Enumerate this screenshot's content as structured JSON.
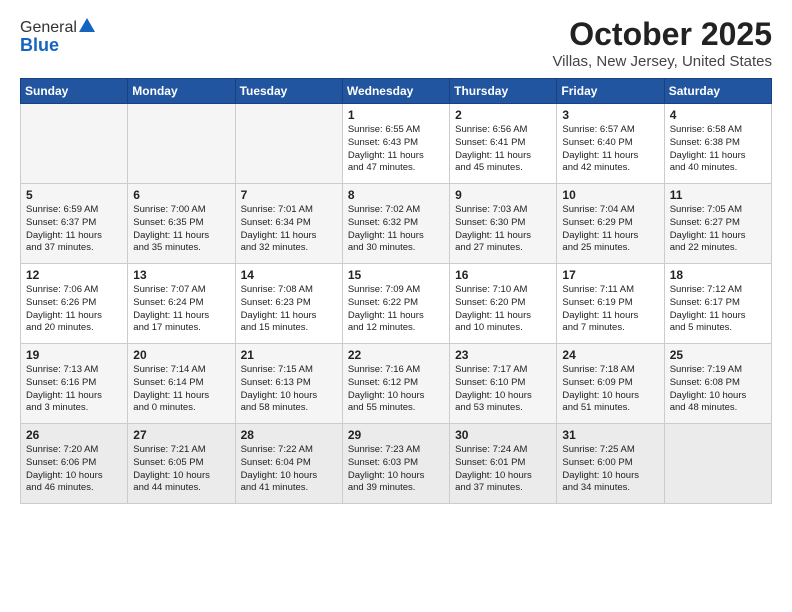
{
  "header": {
    "logo_general": "General",
    "logo_blue": "Blue",
    "title": "October 2025",
    "subtitle": "Villas, New Jersey, United States"
  },
  "weekdays": [
    "Sunday",
    "Monday",
    "Tuesday",
    "Wednesday",
    "Thursday",
    "Friday",
    "Saturday"
  ],
  "weeks": [
    [
      {
        "num": "",
        "info": ""
      },
      {
        "num": "",
        "info": ""
      },
      {
        "num": "",
        "info": ""
      },
      {
        "num": "1",
        "info": "Sunrise: 6:55 AM\nSunset: 6:43 PM\nDaylight: 11 hours\nand 47 minutes."
      },
      {
        "num": "2",
        "info": "Sunrise: 6:56 AM\nSunset: 6:41 PM\nDaylight: 11 hours\nand 45 minutes."
      },
      {
        "num": "3",
        "info": "Sunrise: 6:57 AM\nSunset: 6:40 PM\nDaylight: 11 hours\nand 42 minutes."
      },
      {
        "num": "4",
        "info": "Sunrise: 6:58 AM\nSunset: 6:38 PM\nDaylight: 11 hours\nand 40 minutes."
      }
    ],
    [
      {
        "num": "5",
        "info": "Sunrise: 6:59 AM\nSunset: 6:37 PM\nDaylight: 11 hours\nand 37 minutes."
      },
      {
        "num": "6",
        "info": "Sunrise: 7:00 AM\nSunset: 6:35 PM\nDaylight: 11 hours\nand 35 minutes."
      },
      {
        "num": "7",
        "info": "Sunrise: 7:01 AM\nSunset: 6:34 PM\nDaylight: 11 hours\nand 32 minutes."
      },
      {
        "num": "8",
        "info": "Sunrise: 7:02 AM\nSunset: 6:32 PM\nDaylight: 11 hours\nand 30 minutes."
      },
      {
        "num": "9",
        "info": "Sunrise: 7:03 AM\nSunset: 6:30 PM\nDaylight: 11 hours\nand 27 minutes."
      },
      {
        "num": "10",
        "info": "Sunrise: 7:04 AM\nSunset: 6:29 PM\nDaylight: 11 hours\nand 25 minutes."
      },
      {
        "num": "11",
        "info": "Sunrise: 7:05 AM\nSunset: 6:27 PM\nDaylight: 11 hours\nand 22 minutes."
      }
    ],
    [
      {
        "num": "12",
        "info": "Sunrise: 7:06 AM\nSunset: 6:26 PM\nDaylight: 11 hours\nand 20 minutes."
      },
      {
        "num": "13",
        "info": "Sunrise: 7:07 AM\nSunset: 6:24 PM\nDaylight: 11 hours\nand 17 minutes."
      },
      {
        "num": "14",
        "info": "Sunrise: 7:08 AM\nSunset: 6:23 PM\nDaylight: 11 hours\nand 15 minutes."
      },
      {
        "num": "15",
        "info": "Sunrise: 7:09 AM\nSunset: 6:22 PM\nDaylight: 11 hours\nand 12 minutes."
      },
      {
        "num": "16",
        "info": "Sunrise: 7:10 AM\nSunset: 6:20 PM\nDaylight: 11 hours\nand 10 minutes."
      },
      {
        "num": "17",
        "info": "Sunrise: 7:11 AM\nSunset: 6:19 PM\nDaylight: 11 hours\nand 7 minutes."
      },
      {
        "num": "18",
        "info": "Sunrise: 7:12 AM\nSunset: 6:17 PM\nDaylight: 11 hours\nand 5 minutes."
      }
    ],
    [
      {
        "num": "19",
        "info": "Sunrise: 7:13 AM\nSunset: 6:16 PM\nDaylight: 11 hours\nand 3 minutes."
      },
      {
        "num": "20",
        "info": "Sunrise: 7:14 AM\nSunset: 6:14 PM\nDaylight: 11 hours\nand 0 minutes."
      },
      {
        "num": "21",
        "info": "Sunrise: 7:15 AM\nSunset: 6:13 PM\nDaylight: 10 hours\nand 58 minutes."
      },
      {
        "num": "22",
        "info": "Sunrise: 7:16 AM\nSunset: 6:12 PM\nDaylight: 10 hours\nand 55 minutes."
      },
      {
        "num": "23",
        "info": "Sunrise: 7:17 AM\nSunset: 6:10 PM\nDaylight: 10 hours\nand 53 minutes."
      },
      {
        "num": "24",
        "info": "Sunrise: 7:18 AM\nSunset: 6:09 PM\nDaylight: 10 hours\nand 51 minutes."
      },
      {
        "num": "25",
        "info": "Sunrise: 7:19 AM\nSunset: 6:08 PM\nDaylight: 10 hours\nand 48 minutes."
      }
    ],
    [
      {
        "num": "26",
        "info": "Sunrise: 7:20 AM\nSunset: 6:06 PM\nDaylight: 10 hours\nand 46 minutes."
      },
      {
        "num": "27",
        "info": "Sunrise: 7:21 AM\nSunset: 6:05 PM\nDaylight: 10 hours\nand 44 minutes."
      },
      {
        "num": "28",
        "info": "Sunrise: 7:22 AM\nSunset: 6:04 PM\nDaylight: 10 hours\nand 41 minutes."
      },
      {
        "num": "29",
        "info": "Sunrise: 7:23 AM\nSunset: 6:03 PM\nDaylight: 10 hours\nand 39 minutes."
      },
      {
        "num": "30",
        "info": "Sunrise: 7:24 AM\nSunset: 6:01 PM\nDaylight: 10 hours\nand 37 minutes."
      },
      {
        "num": "31",
        "info": "Sunrise: 7:25 AM\nSunset: 6:00 PM\nDaylight: 10 hours\nand 34 minutes."
      },
      {
        "num": "",
        "info": ""
      }
    ]
  ]
}
